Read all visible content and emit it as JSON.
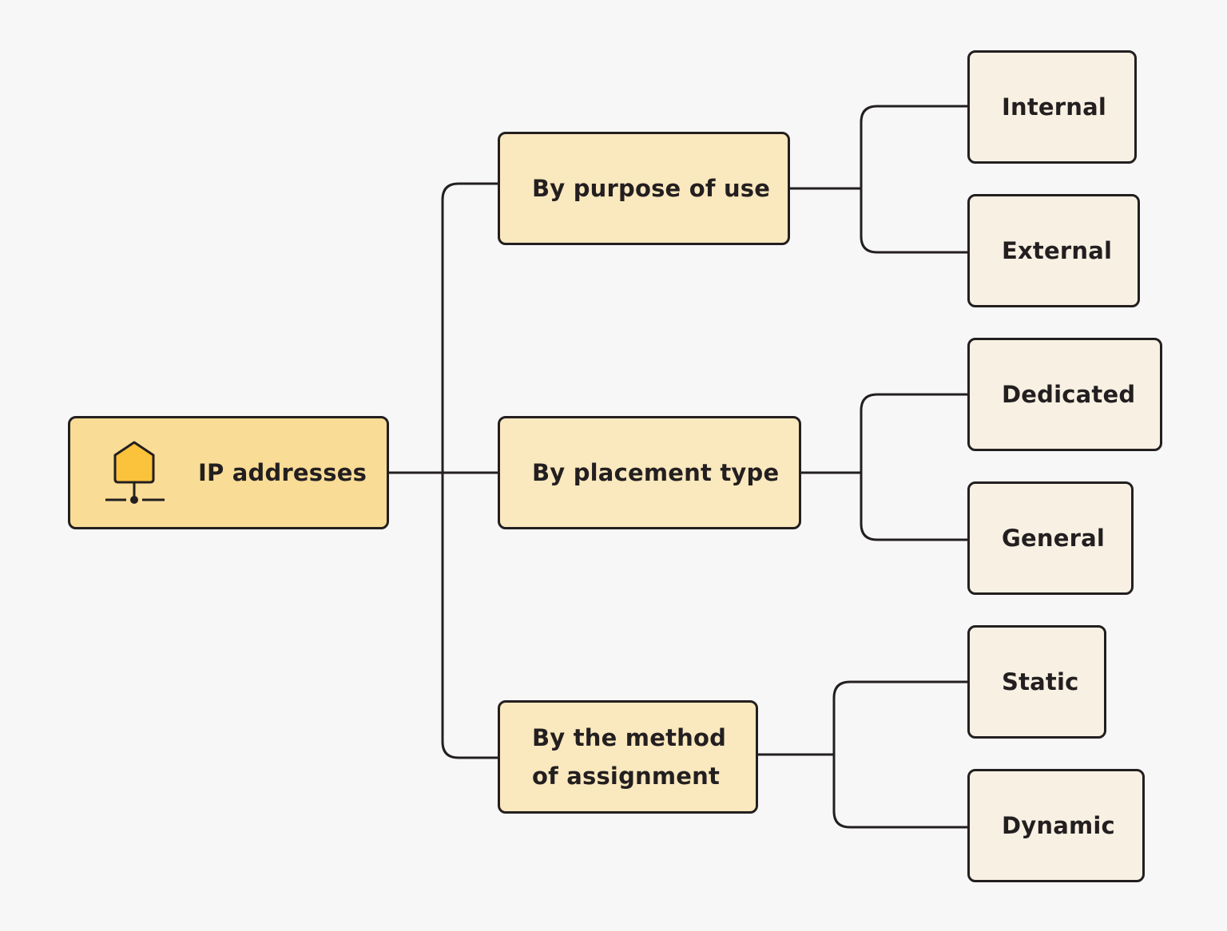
{
  "diagram": {
    "type": "tree",
    "direction": "left-to-right",
    "root": {
      "label": "IP addresses",
      "icon": "network-node-icon"
    },
    "categories": [
      {
        "label": "By purpose of use",
        "children": [
          "Internal",
          "External"
        ]
      },
      {
        "label": "By placement type",
        "children": [
          "Dedicated",
          "General"
        ]
      },
      {
        "label_lines": [
          "By the method",
          "of assignment"
        ],
        "children": [
          "Static",
          "Dynamic"
        ]
      }
    ]
  },
  "colors": {
    "background": "#f7f7f7",
    "stroke": "#231f20",
    "root_fill": "#f9dc96",
    "category_fill": "#fae8be",
    "leaf_fill": "#f8f1e3",
    "icon_fill": "#fbc23b"
  }
}
